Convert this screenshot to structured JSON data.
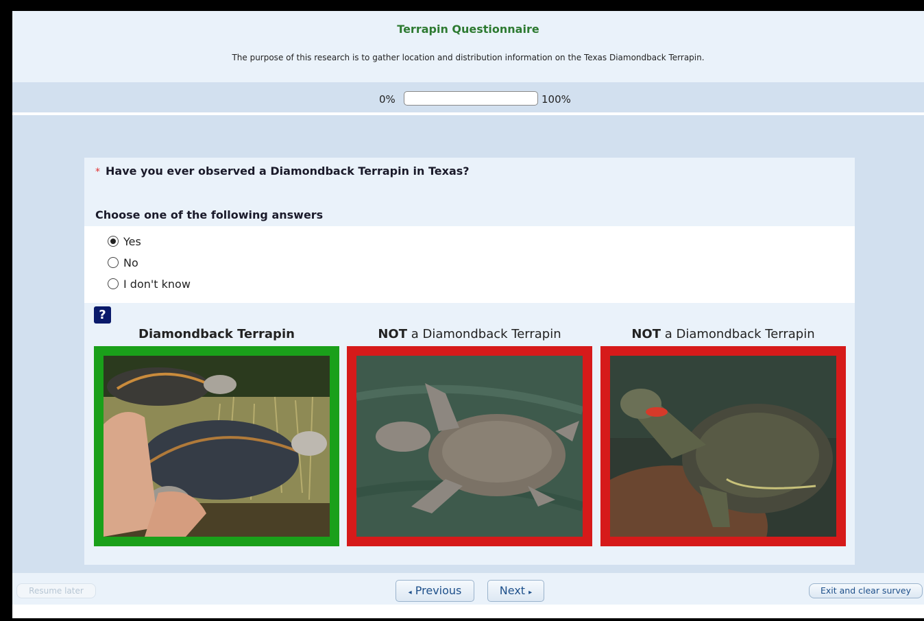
{
  "survey": {
    "title": "Terrapin Questionnaire",
    "description": "The purpose of this research is to gather location and distribution information on the Texas Diamondback Terrapin."
  },
  "progress": {
    "left_label": "0%",
    "right_label": "100%",
    "value": 0
  },
  "question": {
    "required_marker": "*",
    "text": "Have you ever observed a Diamondback Terrapin in Texas?",
    "help": "Choose one of the following answers",
    "answers": [
      {
        "label": "Yes",
        "checked": true
      },
      {
        "label": "No",
        "checked": false
      },
      {
        "label": "I don't know",
        "checked": false
      }
    ],
    "help_icon": "?"
  },
  "images": [
    {
      "caption_bold": "Diamondback Terrapin",
      "caption_rest": "",
      "status": "correct",
      "border_color": "#1aa01a"
    },
    {
      "caption_bold": "NOT",
      "caption_rest": " a Diamondback Terrapin",
      "status": "incorrect",
      "border_color": "#d61a1a"
    },
    {
      "caption_bold": "NOT",
      "caption_rest": " a Diamondback Terrapin",
      "status": "incorrect",
      "border_color": "#d61a1a"
    }
  ],
  "footer": {
    "resume_label": "Resume later",
    "prev_label": "Previous",
    "next_label": "Next",
    "exit_label": "Exit and clear survey"
  },
  "colors": {
    "title_green": "#2d7a31",
    "header_bg": "#eaf2fa",
    "band_bg": "#d2e0ef",
    "link_blue": "#1d4f8a"
  }
}
